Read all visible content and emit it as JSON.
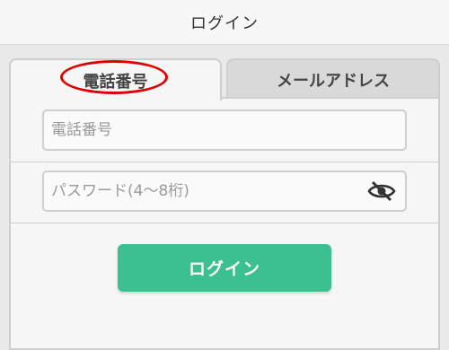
{
  "header": {
    "title": "ログイン"
  },
  "tabs": [
    {
      "label": "電話番号",
      "active": true
    },
    {
      "label": "メールアドレス",
      "active": false
    }
  ],
  "form": {
    "phone": {
      "value": "",
      "placeholder": "電話番号"
    },
    "password": {
      "value": "",
      "placeholder": "パスワード(4〜8桁)",
      "toggle_icon": "eye-slash-icon"
    },
    "submit_label": "ログイン"
  },
  "colors": {
    "accent": "#3cc08f",
    "highlight_annotation": "#e10000"
  }
}
